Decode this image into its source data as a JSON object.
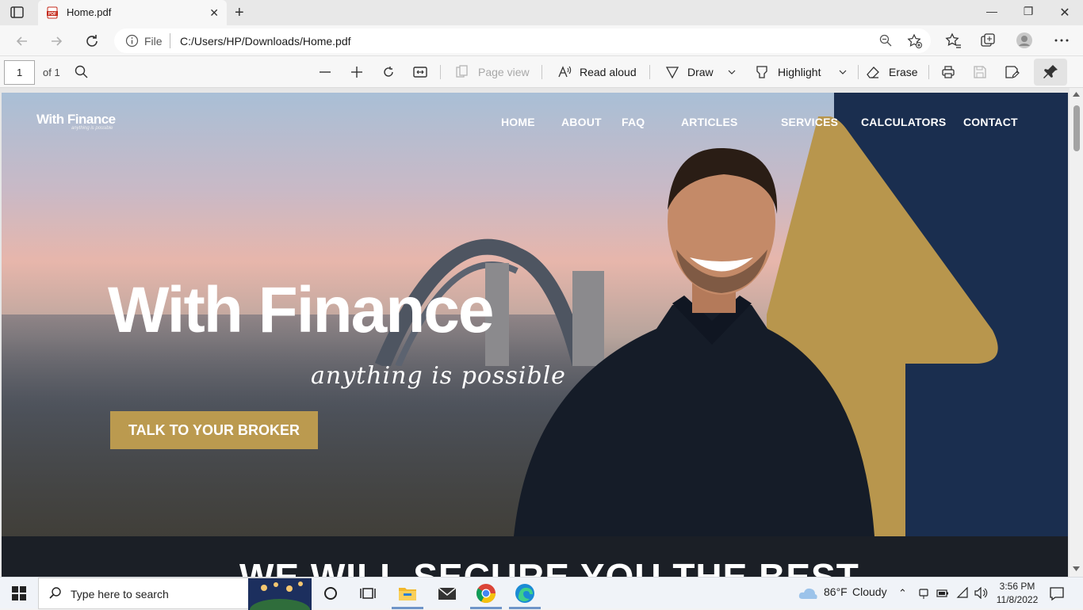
{
  "browser": {
    "tab_title": "Home.pdf",
    "address_scheme": "File",
    "address_url": "C:/Users/HP/Downloads/Home.pdf"
  },
  "pdf_toolbar": {
    "page_number": "1",
    "page_total": "of 1",
    "page_view_label": "Page view",
    "read_aloud_label": "Read aloud",
    "draw_label": "Draw",
    "highlight_label": "Highlight",
    "erase_label": "Erase"
  },
  "site": {
    "logo": "With Finance",
    "logo_sub": "anything is possible",
    "nav": [
      "HOME",
      "ABOUT",
      "FAQ",
      "ARTICLES",
      "SERVICES",
      "CALCULATORS",
      "CONTACT"
    ],
    "hero_title": "With Finance",
    "hero_tagline": "anything is possible",
    "cta_label": "TALK TO YOUR BROKER",
    "section_title": "WE WILL SECURE YOU THE BEST",
    "colors": {
      "navy": "#1a2e4f",
      "gold": "#bb9a4f",
      "dark_band": "#1b1f26"
    }
  },
  "taskbar": {
    "search_placeholder": "Type here to search",
    "weather_temp": "86°F",
    "weather_desc": "Cloudy",
    "time": "3:56 PM",
    "date": "11/8/2022"
  }
}
